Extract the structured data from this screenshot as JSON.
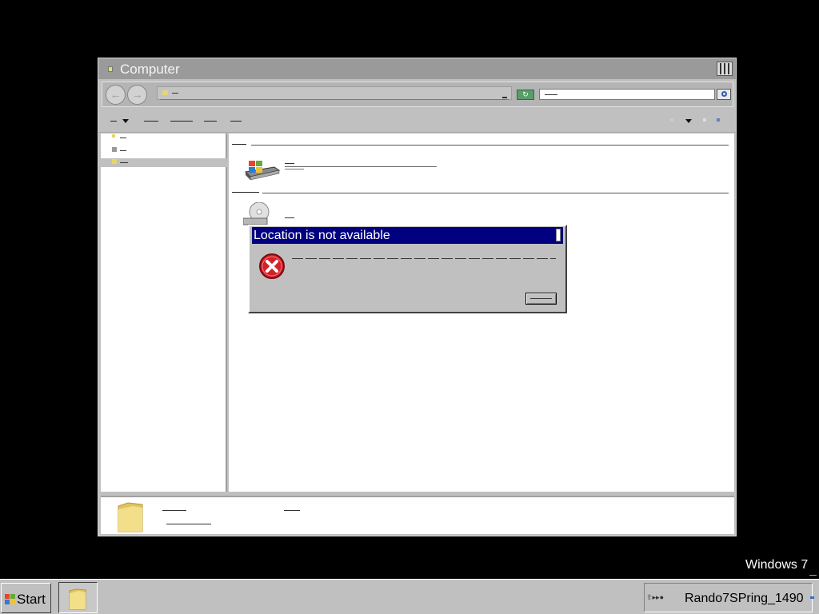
{
  "window": {
    "title": "Computer"
  },
  "dialog": {
    "title": "Location is not available"
  },
  "desktop": {
    "watermark": "Windows 7"
  },
  "taskbar": {
    "start_label": "Start",
    "clock": "Rando7SPring_1490"
  },
  "icons": {
    "window_icon": "folder-icon",
    "dialog_icon": "error-icon",
    "start_icon": "windows-logo-icon"
  },
  "colors": {
    "dialog_title_bg": "#000080",
    "error_red": "#d4202a",
    "window_title_bg": "#9a9a9a"
  }
}
